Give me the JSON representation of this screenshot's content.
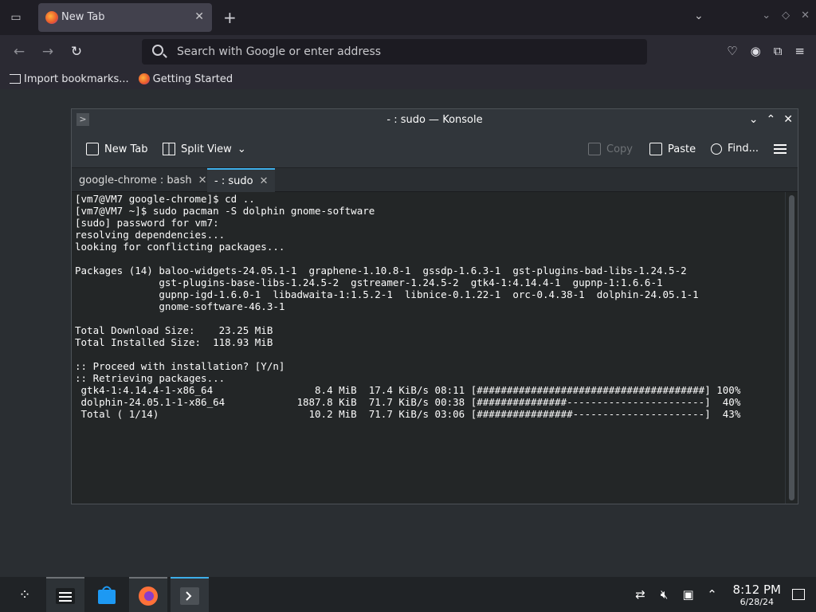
{
  "browser": {
    "tab_title": "New Tab",
    "url_placeholder": "Search with Google or enter address",
    "bookmarks": [
      "Import bookmarks...",
      "Getting Started"
    ]
  },
  "konsole": {
    "window_title": "- : sudo — Konsole",
    "toolbar": {
      "new_tab": "New Tab",
      "split_view": "Split View",
      "copy": "Copy",
      "paste": "Paste",
      "find": "Find..."
    },
    "tabs": [
      "google-chrome : bash",
      "- : sudo"
    ],
    "terminal_lines": [
      "[vm7@VM7 google-chrome]$ cd ..",
      "[vm7@VM7 ~]$ sudo pacman -S dolphin gnome-software",
      "[sudo] password for vm7:",
      "resolving dependencies...",
      "looking for conflicting packages...",
      "",
      "Packages (14) baloo-widgets-24.05.1-1  graphene-1.10.8-1  gssdp-1.6.3-1  gst-plugins-bad-libs-1.24.5-2",
      "              gst-plugins-base-libs-1.24.5-2  gstreamer-1.24.5-2  gtk4-1:4.14.4-1  gupnp-1:1.6.6-1",
      "              gupnp-igd-1.6.0-1  libadwaita-1:1.5.2-1  libnice-0.1.22-1  orc-0.4.38-1  dolphin-24.05.1-1",
      "              gnome-software-46.3-1",
      "",
      "Total Download Size:    23.25 MiB",
      "Total Installed Size:  118.93 MiB",
      "",
      ":: Proceed with installation? [Y/n]",
      ":: Retrieving packages...",
      " gtk4-1:4.14.4-1-x86_64                 8.4 MiB  17.4 KiB/s 08:11 [######################################] 100%",
      " dolphin-24.05.1-1-x86_64            1887.8 KiB  71.7 KiB/s 00:38 [###############-----------------------]  40%",
      " Total ( 1/14)                         10.2 MiB  71.7 KiB/s 03:06 [################----------------------]  43%"
    ]
  },
  "tray": {
    "time": "8:12 PM",
    "date": "6/28/24"
  }
}
